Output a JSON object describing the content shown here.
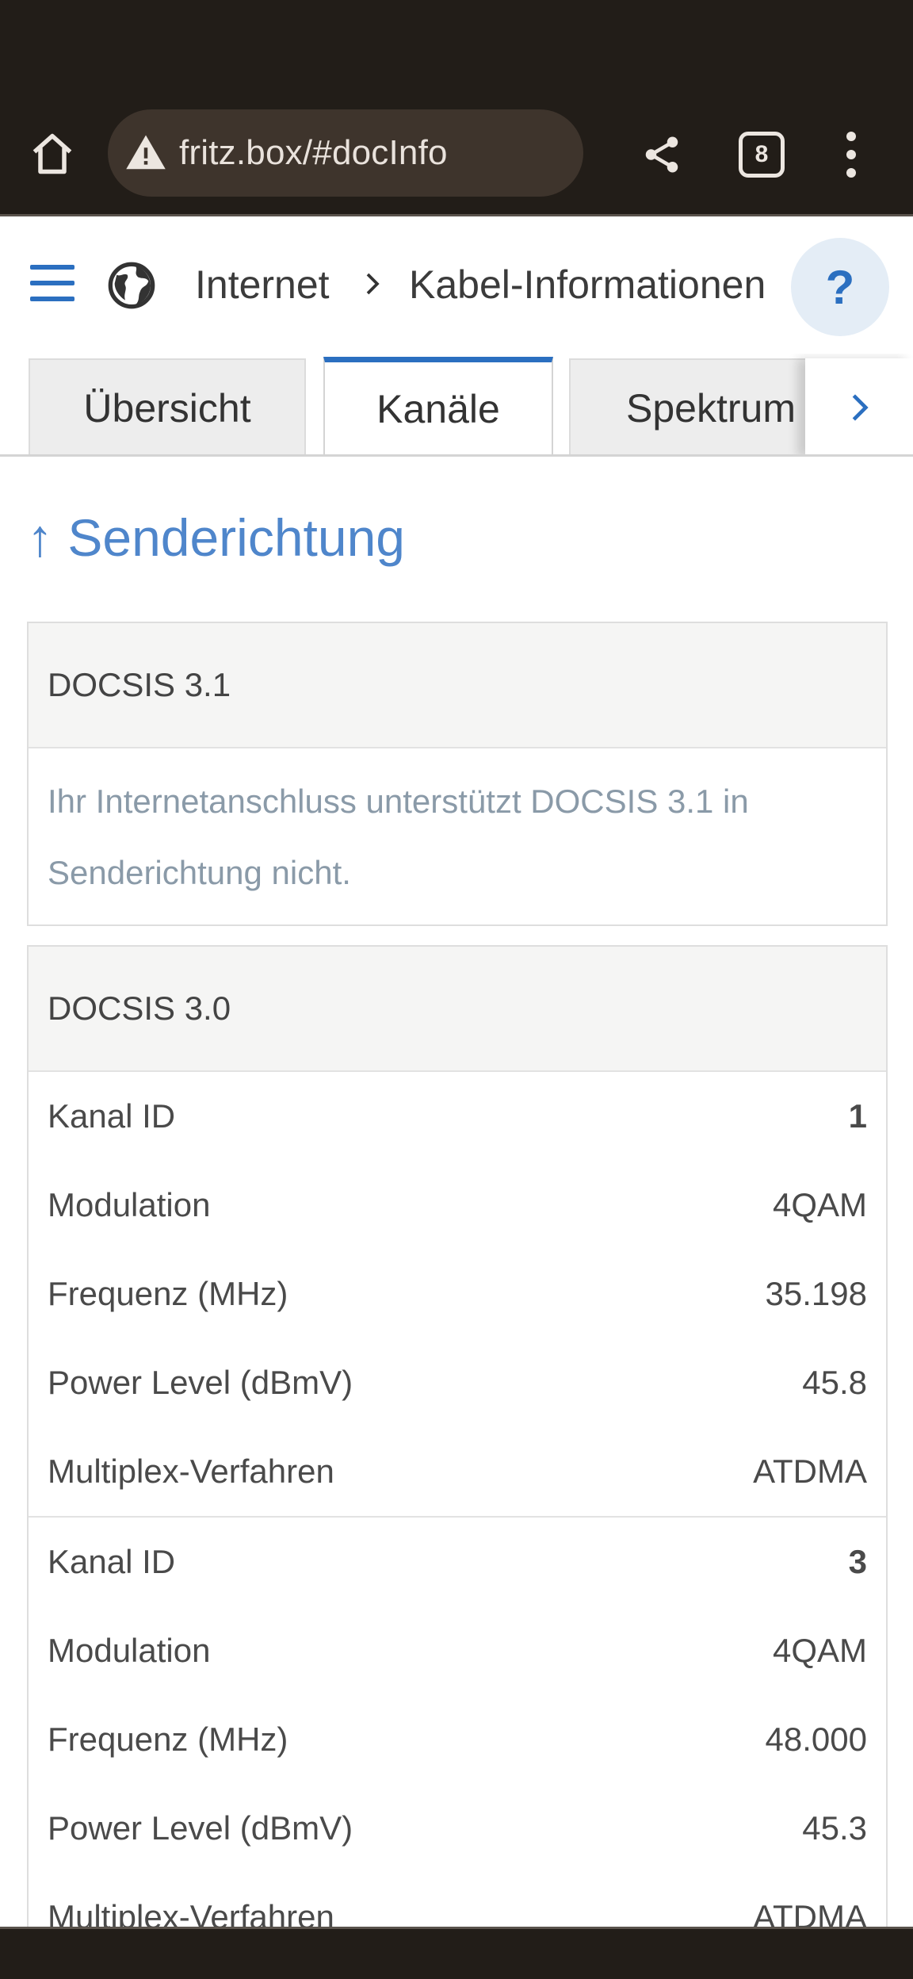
{
  "browser": {
    "url": "fritz.box/#docInfo",
    "tab_count": "8"
  },
  "header": {
    "breadcrumb_root": "Internet",
    "breadcrumb_page": "Kabel-Informationen",
    "help_label": "?"
  },
  "tabs": [
    {
      "label": "Übersicht",
      "active": false
    },
    {
      "label": "Kanäle",
      "active": true
    },
    {
      "label": "Spektrum",
      "active": false
    }
  ],
  "section": {
    "title": "↑ Senderichtung"
  },
  "docsis31": {
    "heading": "DOCSIS 3.1",
    "note": "Ihr Internetanschluss unterstützt DOCSIS 3.1 in Senderichtung nicht."
  },
  "docsis30": {
    "heading": "DOCSIS 3.0",
    "channels": [
      {
        "rows": [
          {
            "label": "Kanal ID",
            "value": "1"
          },
          {
            "label": "Modulation",
            "value": "4QAM"
          },
          {
            "label": "Frequenz (MHz)",
            "value": "35.198"
          },
          {
            "label": "Power Level (dBmV)",
            "value": "45.8"
          },
          {
            "label": "Multiplex-Verfahren",
            "value": "ATDMA"
          }
        ]
      },
      {
        "rows": [
          {
            "label": "Kanal ID",
            "value": "3"
          },
          {
            "label": "Modulation",
            "value": "4QAM"
          },
          {
            "label": "Frequenz (MHz)",
            "value": "48.000"
          },
          {
            "label": "Power Level (dBmV)",
            "value": "45.3"
          },
          {
            "label": "Multiplex-Verfahren",
            "value": "ATDMA"
          }
        ]
      }
    ]
  },
  "colors": {
    "accent": "#2b6fc0",
    "title": "#4f86cb",
    "chrome": "#221d18"
  }
}
